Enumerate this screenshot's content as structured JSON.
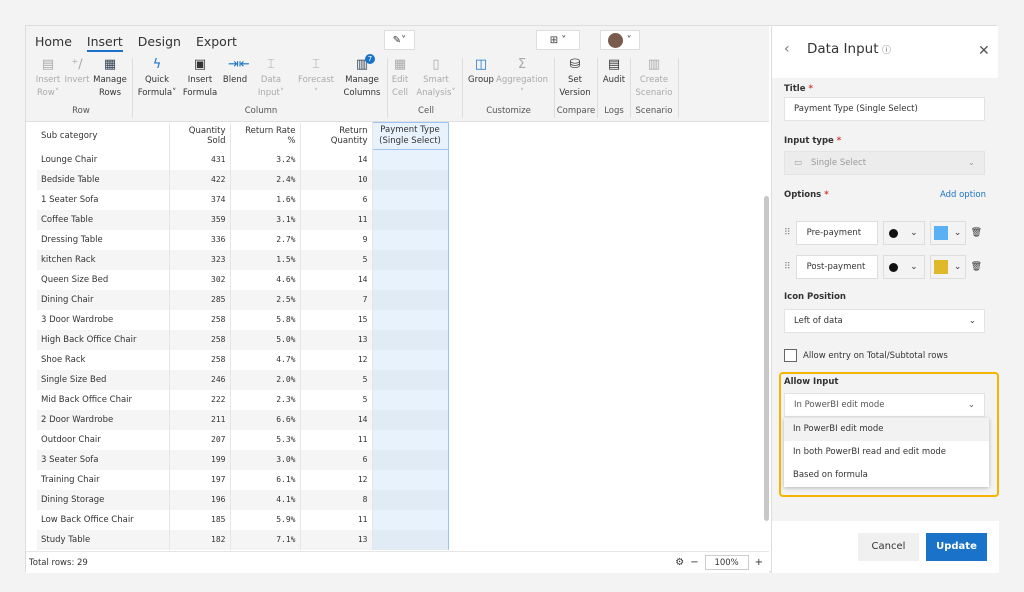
{
  "ribbon": {
    "tabs": [
      "Home",
      "Insert",
      "Design",
      "Export"
    ],
    "active_tab": "Insert",
    "tools": [
      {
        "label": "Insert Row",
        "disabled": true,
        "icon": "insert-row-icon"
      },
      {
        "label": "Invert",
        "disabled": true,
        "icon": "invert-icon"
      },
      {
        "label": "Manage Rows",
        "disabled": false,
        "icon": "manage-rows-icon"
      },
      {
        "label": "Quick Formula",
        "disabled": false,
        "icon": "lightning-icon"
      },
      {
        "label": "Insert Formula",
        "disabled": false,
        "icon": "formula-icon"
      },
      {
        "label": "Blend",
        "disabled": false,
        "icon": "blend-icon"
      },
      {
        "label": "Data Input",
        "disabled": true,
        "icon": "data-input-icon"
      },
      {
        "label": "Forecast",
        "disabled": true,
        "icon": "forecast-icon"
      },
      {
        "label": "Manage Columns",
        "disabled": false,
        "icon": "manage-columns-icon",
        "badge": "7"
      },
      {
        "label": "Edit Cell",
        "disabled": true,
        "icon": "edit-cell-icon"
      },
      {
        "label": "Smart Analysis",
        "disabled": true,
        "icon": "smart-analysis-icon"
      },
      {
        "label": "Group",
        "disabled": false,
        "icon": "group-icon"
      },
      {
        "label": "Aggregation",
        "disabled": true,
        "icon": "sigma-icon"
      },
      {
        "label": "Set Version",
        "disabled": false,
        "icon": "version-icon"
      },
      {
        "label": "Audit",
        "disabled": false,
        "icon": "audit-icon"
      },
      {
        "label": "Create Scenario",
        "disabled": true,
        "icon": "scenario-icon"
      }
    ],
    "groups": [
      "Row",
      "Column",
      "Cell",
      "Customize",
      "Compare",
      "Logs",
      "Scenario"
    ]
  },
  "table": {
    "columns": [
      "Sub category",
      "Quantity Sold",
      "Return Rate %",
      "Return Quantity",
      "Payment Type (Single Select)"
    ],
    "rows": [
      [
        "Lounge Chair",
        "431",
        "3.2%",
        "14"
      ],
      [
        "Bedside Table",
        "422",
        "2.4%",
        "10"
      ],
      [
        "1 Seater Sofa",
        "374",
        "1.6%",
        "6"
      ],
      [
        "Coffee Table",
        "359",
        "3.1%",
        "11"
      ],
      [
        "Dressing Table",
        "336",
        "2.7%",
        "9"
      ],
      [
        "kitchen Rack",
        "323",
        "1.5%",
        "5"
      ],
      [
        "Queen Size Bed",
        "302",
        "4.6%",
        "14"
      ],
      [
        "Dining Chair",
        "285",
        "2.5%",
        "7"
      ],
      [
        "3 Door Wardrobe",
        "258",
        "5.8%",
        "15"
      ],
      [
        "High Back Office Chair",
        "258",
        "5.0%",
        "13"
      ],
      [
        "Shoe Rack",
        "258",
        "4.7%",
        "12"
      ],
      [
        "Single Size Bed",
        "246",
        "2.0%",
        "5"
      ],
      [
        "Mid Back Office Chair",
        "222",
        "2.3%",
        "5"
      ],
      [
        "2 Door Wardrobe",
        "211",
        "6.6%",
        "14"
      ],
      [
        "Outdoor Chair",
        "207",
        "5.3%",
        "11"
      ],
      [
        "3 Seater Sofa",
        "199",
        "3.0%",
        "6"
      ],
      [
        "Training Chair",
        "197",
        "6.1%",
        "12"
      ],
      [
        "Dining Storage",
        "196",
        "4.1%",
        "8"
      ],
      [
        "Low Back Office Chair",
        "185",
        "5.9%",
        "11"
      ],
      [
        "Study Table",
        "182",
        "7.1%",
        "13"
      ]
    ]
  },
  "footer": {
    "total": "Total rows: 29",
    "zoom": "100%"
  },
  "panel": {
    "title": "Data Input",
    "title_label": "Title",
    "title_value": "Payment Type (Single Select)",
    "input_type_label": "Input type",
    "input_type_value": "Single Select",
    "options_label": "Options",
    "add_option": "Add option",
    "options": [
      {
        "label": "Pre-payment",
        "color": "#5ab0f5"
      },
      {
        "label": "Post-payment",
        "color": "#e0b92b"
      }
    ],
    "icon_position_label": "Icon Position",
    "icon_position_value": "Left of data",
    "allow_total_label": "Allow entry on Total/Subtotal rows",
    "allow_input_label": "Allow Input",
    "allow_input_value": "In PowerBI edit mode",
    "allow_input_options": [
      "In PowerBI edit mode",
      "In both PowerBI read and edit mode",
      "Based on formula"
    ],
    "cancel": "Cancel",
    "update": "Update"
  },
  "colors": {
    "accent": "#1a73c8",
    "highlight": "#f5b400"
  }
}
